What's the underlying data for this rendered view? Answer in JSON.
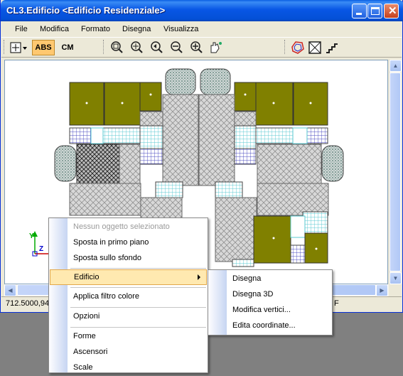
{
  "window": {
    "title": "CL3.Edificio <Edificio Residenziale>"
  },
  "menu": [
    "File",
    "Modifica",
    "Formato",
    "Disegna",
    "Visualizza"
  ],
  "toolbar": {
    "abs_label": "ABS",
    "cm_label": "CM",
    "zoom_icons": [
      "zoom-window-icon",
      "zoom-all-icon",
      "zoom-previous-icon",
      "zoom-out-icon",
      "zoom-in-icon",
      "pan-icon"
    ],
    "draw_icons": [
      "polygon-icon",
      "frame-icon",
      "stairs-icon"
    ]
  },
  "status": {
    "coordinates": "712.5000,94",
    "mode": "F"
  },
  "axis": {
    "x": "X",
    "y": "Y",
    "z": "Z"
  },
  "context_menu": {
    "items": [
      {
        "label": "Nessun oggetto selezionato",
        "disabled": true
      },
      {
        "label": "Sposta in primo piano"
      },
      {
        "label": "Sposta sullo sfondo"
      },
      {
        "label": "Edificio",
        "submenu": true
      },
      {
        "label": "Applica filtro colore"
      },
      {
        "label": "Opzioni"
      },
      {
        "label": "Forme"
      },
      {
        "label": "Ascensori"
      },
      {
        "label": "Scale"
      }
    ]
  },
  "submenu": {
    "items": [
      "Disegna",
      "Disegna 3D",
      "Modifica vertici...",
      "Edita coordinate..."
    ]
  },
  "colors": {
    "title_blue": "#0A5EE3",
    "olive": "#808000",
    "highlight": "#FFE9B0"
  }
}
